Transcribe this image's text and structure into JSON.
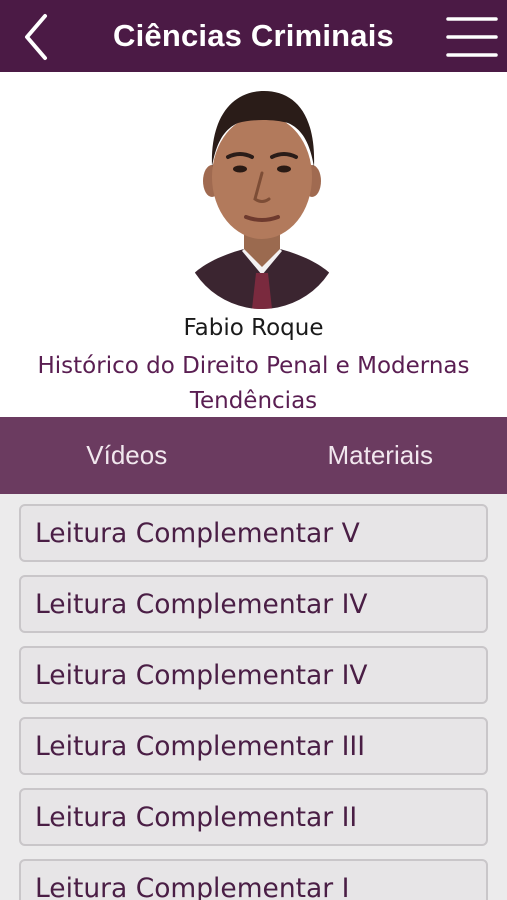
{
  "header": {
    "title": "Ciências Criminais",
    "back_icon": "chevron-left-icon",
    "menu_icon": "hamburger-menu-icon"
  },
  "profile": {
    "name": "Fabio Roque",
    "lecture_title": "Histórico do Direito Penal e Modernas Tendências"
  },
  "tabs": [
    {
      "label": "Vídeos"
    },
    {
      "label": "Materiais"
    }
  ],
  "materials": [
    {
      "label": "Leitura Complementar V"
    },
    {
      "label": "Leitura Complementar IV"
    },
    {
      "label": "Leitura Complementar IV"
    },
    {
      "label": "Leitura Complementar III"
    },
    {
      "label": "Leitura Complementar II"
    },
    {
      "label": "Leitura Complementar I"
    }
  ],
  "colors": {
    "header_bg": "#4b1a45",
    "tab_bar_bg": "#6b3b60",
    "accent_text": "#5a1e52",
    "list_bg": "#ecebec"
  }
}
